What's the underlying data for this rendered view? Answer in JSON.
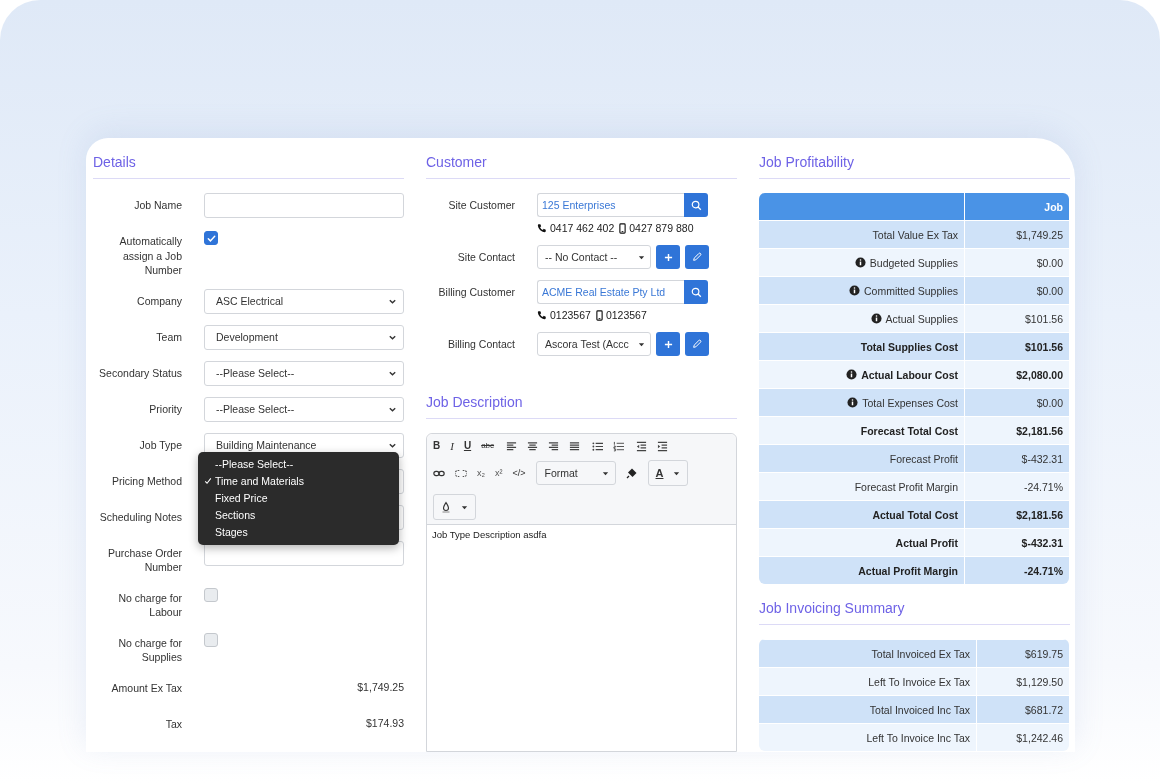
{
  "details": {
    "title": "Details",
    "fields": [
      {
        "kind": "text",
        "label": "Job Name"
      },
      {
        "kind": "checkbox",
        "label": "Automatically assign a Job Number",
        "checked": true
      },
      {
        "kind": "select",
        "label": "Company",
        "value": "ASC Electrical"
      },
      {
        "kind": "select",
        "label": "Team",
        "value": "Development"
      },
      {
        "kind": "select",
        "label": "Secondary Status",
        "value": "--Please Select--"
      },
      {
        "kind": "select",
        "label": "Priority",
        "value": "--Please Select--"
      },
      {
        "kind": "select",
        "label": "Job Type",
        "value": "Building Maintenance"
      },
      {
        "kind": "select",
        "label": "Pricing Method",
        "menu": [
          {
            "label": "--Please Select--",
            "selected": false
          },
          {
            "label": "Time and Materials",
            "selected": true
          },
          {
            "label": "Fixed Price",
            "selected": false
          },
          {
            "label": "Sections",
            "selected": false
          },
          {
            "label": "Stages",
            "selected": false
          }
        ]
      },
      {
        "kind": "text",
        "label": "Scheduling Notes"
      },
      {
        "kind": "text",
        "label": "Purchase Order Number"
      },
      {
        "kind": "checkbox",
        "label": "No charge for Labour",
        "checked": false
      },
      {
        "kind": "checkbox",
        "label": "No charge for Supplies",
        "checked": false
      },
      {
        "kind": "amount",
        "label": "Amount Ex Tax",
        "value": "$1,749.25"
      },
      {
        "kind": "amount",
        "label": "Tax",
        "value": "$174.93"
      }
    ]
  },
  "customer": {
    "title": "Customer",
    "rows": [
      {
        "kind": "lookup",
        "label": "Site Customer",
        "value": "125 Enterprises",
        "phone": "0417 462 402",
        "mobile": "0427 879 880"
      },
      {
        "kind": "contact",
        "label": "Site Contact",
        "value": "-- No Contact --"
      },
      {
        "kind": "lookup",
        "label": "Billing Customer",
        "value": "ACME Real Estate Pty Ltd",
        "phone": "0123567",
        "mobile": "0123567"
      },
      {
        "kind": "contact",
        "label": "Billing Contact",
        "value": "Ascora Test (Accc"
      }
    ]
  },
  "job_description": {
    "title": "Job Description",
    "toolbar": {
      "bold": "B",
      "italic": "I",
      "underline": "U",
      "strikethrough": "abc",
      "subscript": "x₂",
      "superscript": "x²",
      "code": "</>",
      "format": "Format",
      "font_color": "A"
    },
    "content": "Job Type Description asdfa"
  },
  "profitability": {
    "title": "Job Profitability",
    "column": "Job",
    "rows": [
      {
        "label": "Total Value Ex Tax",
        "value": "$1,749.25",
        "bold": false,
        "info": false
      },
      {
        "label": "Budgeted Supplies",
        "value": "$0.00",
        "bold": false,
        "info": true
      },
      {
        "label": "Committed Supplies",
        "value": "$0.00",
        "bold": false,
        "info": true
      },
      {
        "label": "Actual Supplies",
        "value": "$101.56",
        "bold": false,
        "info": true
      },
      {
        "label": "Total Supplies Cost",
        "value": "$101.56",
        "bold": true,
        "info": false
      },
      {
        "label": "Actual Labour Cost",
        "value": "$2,080.00",
        "bold": true,
        "info": true
      },
      {
        "label": "Total Expenses Cost",
        "value": "$0.00",
        "bold": false,
        "info": true
      },
      {
        "label": "Forecast Total Cost",
        "value": "$2,181.56",
        "bold": true,
        "info": false
      },
      {
        "label": "Forecast Profit",
        "value": "$-432.31",
        "bold": false,
        "info": false
      },
      {
        "label": "Forecast Profit Margin",
        "value": "-24.71%",
        "bold": false,
        "info": false
      },
      {
        "label": "Actual Total Cost",
        "value": "$2,181.56",
        "bold": true,
        "info": false
      },
      {
        "label": "Actual Profit",
        "value": "$-432.31",
        "bold": true,
        "info": false
      },
      {
        "label": "Actual Profit Margin",
        "value": "-24.71%",
        "bold": true,
        "info": false
      }
    ]
  },
  "invoicing": {
    "title": "Job Invoicing Summary",
    "rows": [
      {
        "label": "Total Invoiced Ex Tax",
        "value": "$619.75"
      },
      {
        "label": "Left To Invoice Ex Tax",
        "value": "$1,129.50"
      },
      {
        "label": "Total Invoiced Inc Tax",
        "value": "$681.72"
      },
      {
        "label": "Left To Invoice Inc Tax",
        "value": "$1,242.46"
      }
    ]
  }
}
